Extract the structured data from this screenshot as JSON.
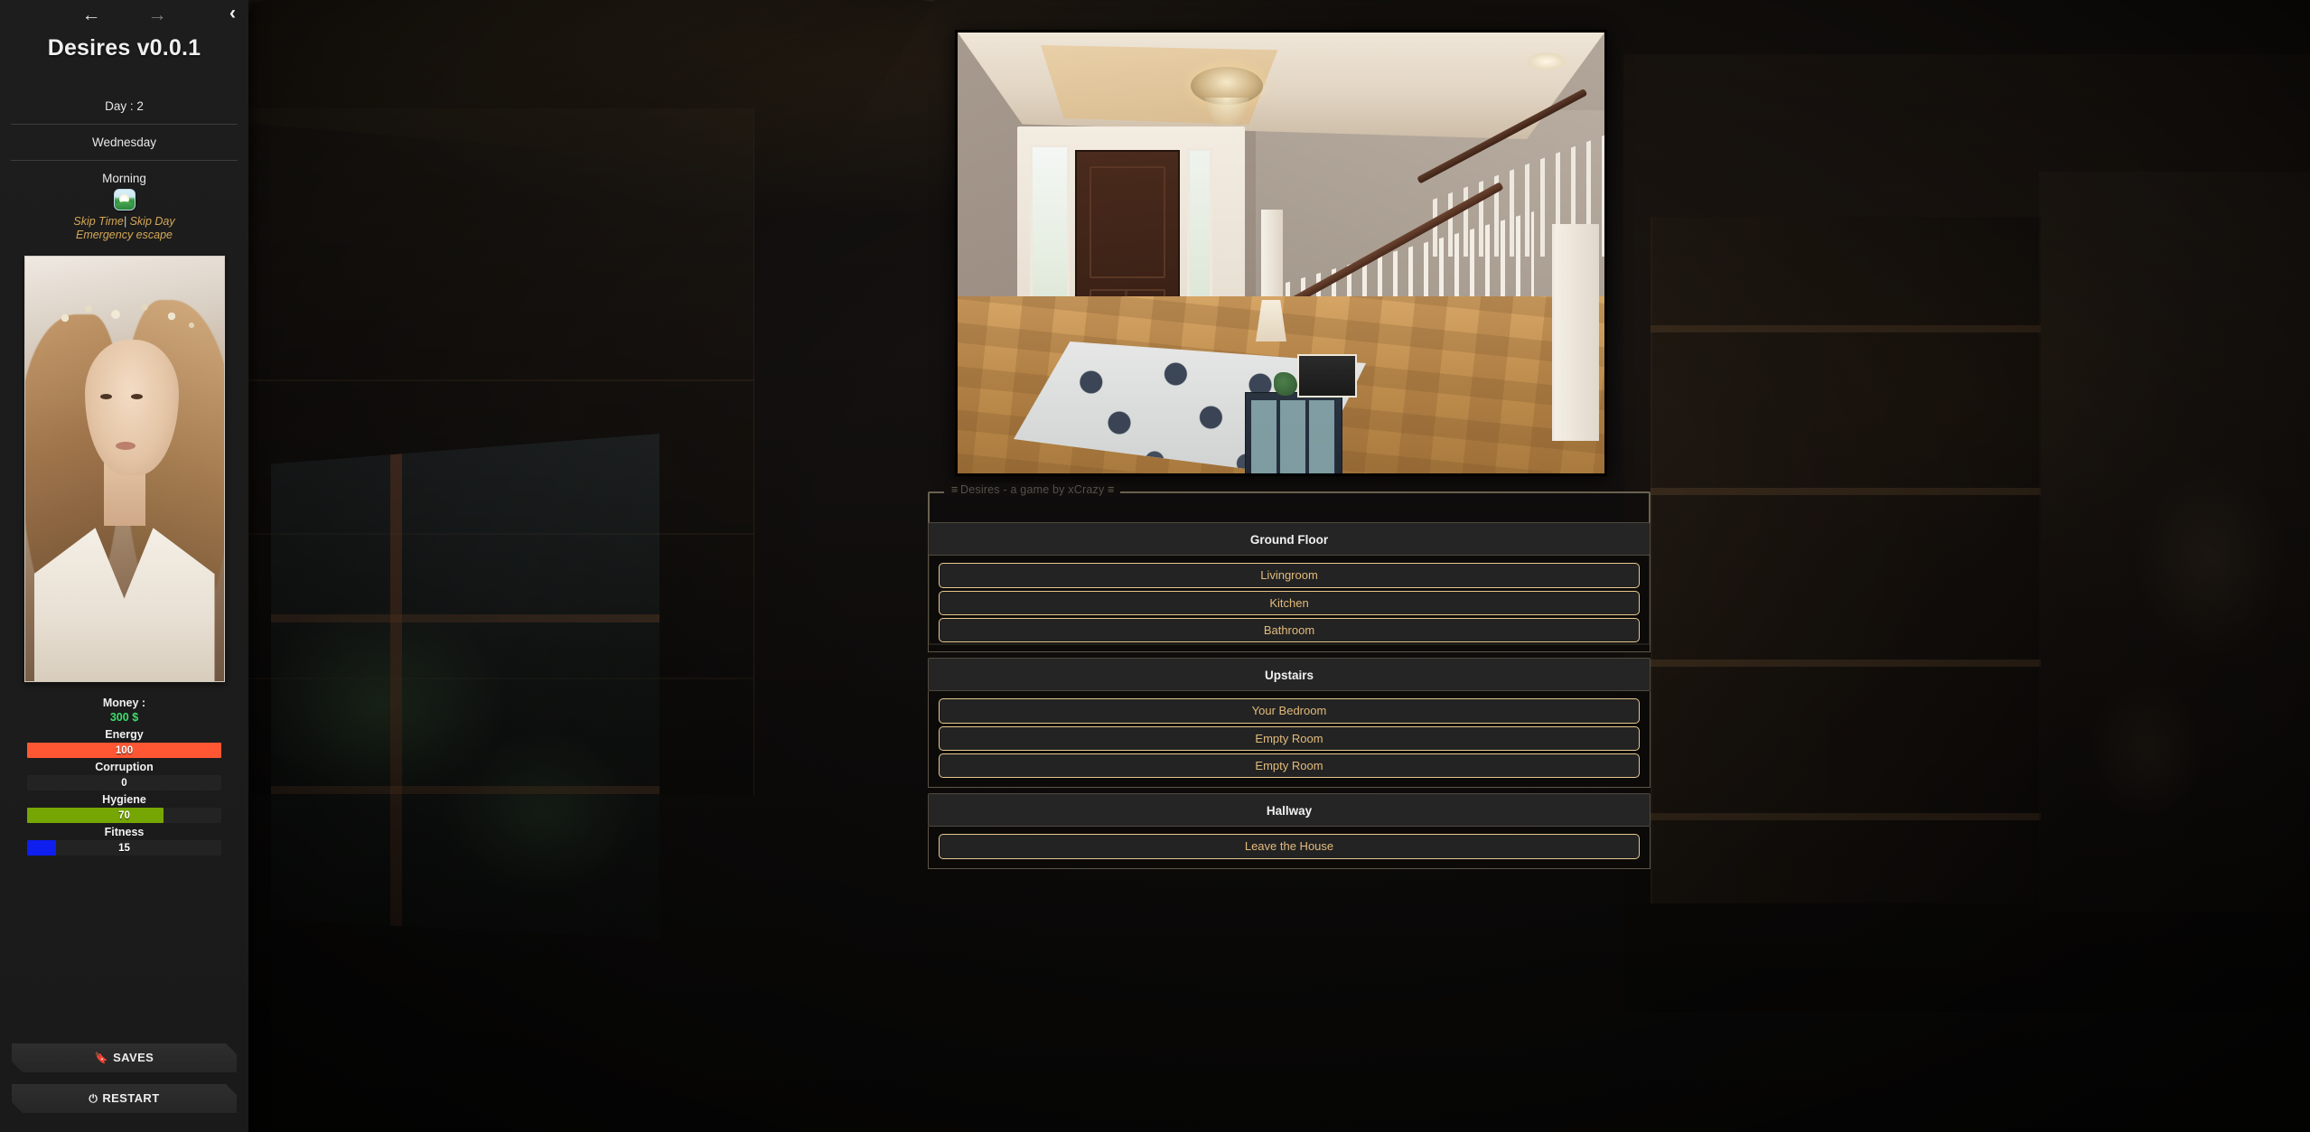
{
  "app": {
    "title": "Desires v0.0.1",
    "footer_credit": "Desires - a game by xCrazy"
  },
  "nav": {
    "back_icon": "arrow-left-icon",
    "forward_icon": "arrow-right-icon",
    "collapse_icon": "chevron-left-icon",
    "back_label": "←",
    "forward_label": "→",
    "collapse_label": "‹"
  },
  "status": {
    "day_label": "Day : 2",
    "weekday": "Wednesday",
    "period": "Morning",
    "period_icon": "sunrise-icon",
    "skip_time": "Skip Time",
    "skip_separator": "|",
    "skip_day": "Skip Day",
    "emergency_escape": "Emergency escape"
  },
  "portrait": {
    "alt": "player-portrait"
  },
  "stats": {
    "money_label": "Money :",
    "money_value": "300 $",
    "money_color": "#3ddc6b",
    "bars": [
      {
        "label": "Energy",
        "value": 100,
        "display": "100",
        "percent": 100,
        "color": "#ff5733"
      },
      {
        "label": "Corruption",
        "value": 0,
        "display": "0",
        "percent": 0,
        "color": "#7f3fbf"
      },
      {
        "label": "Hygiene",
        "value": 70,
        "display": "70",
        "percent": 70,
        "color": "#76a603"
      },
      {
        "label": "Fitness",
        "value": 15,
        "display": "15",
        "percent": 15,
        "color": "#0e1ff0"
      }
    ]
  },
  "sidebar_buttons": {
    "saves": {
      "label": "SAVES",
      "icon": "bookmark-icon",
      "glyph": "🔖"
    },
    "restart": {
      "label": "RESTART",
      "icon": "power-icon",
      "glyph": "⏻"
    }
  },
  "scene": {
    "image_alt": "house-entryway-hallway-photo"
  },
  "menu": {
    "legend": "Desires - a game by xCrazy",
    "sections": [
      {
        "heading": "Ground Floor",
        "rooms": [
          "Livingroom",
          "Kitchen",
          "Bathroom"
        ]
      },
      {
        "heading": "Upstairs",
        "rooms": [
          "Your Bedroom",
          "Empty Room",
          "Empty Room"
        ]
      },
      {
        "heading": "Hallway",
        "rooms": [
          "Leave the House"
        ]
      }
    ]
  },
  "colors": {
    "accent_gold": "#e8c88f",
    "text_gold": "#e3bb7c",
    "panel_border": "#6a6250",
    "sidebar_bg": "#1c1c1c",
    "link_gold": "#d4a857"
  }
}
